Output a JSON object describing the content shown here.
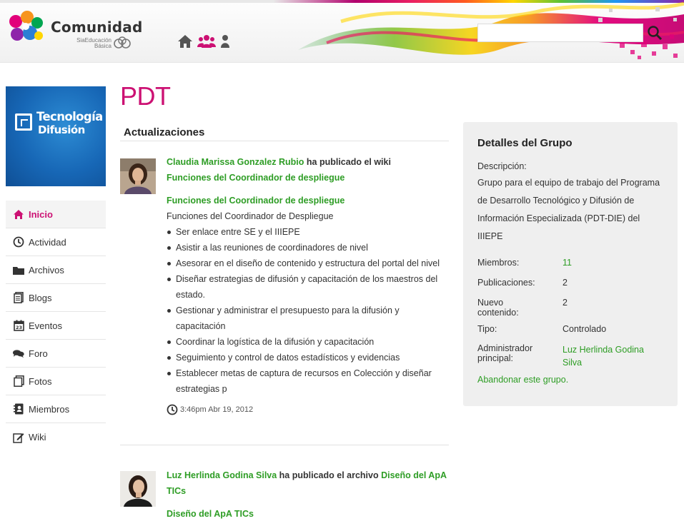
{
  "header": {
    "brand": "Comunidad",
    "brand_sub_line1": "SiaEducación",
    "brand_sub_line2": "Básica",
    "search_placeholder": "",
    "nav_icons": [
      "home-icon",
      "groups-icon",
      "profile-icon"
    ],
    "accent": "#cc1173"
  },
  "sidebar": {
    "owner_image_line1": "Tecnología",
    "owner_image_line2": "Difusión",
    "items": [
      {
        "label": "Inicio",
        "icon": "home-icon",
        "active": true
      },
      {
        "label": "Actividad",
        "icon": "clock-icon"
      },
      {
        "label": "Archivos",
        "icon": "folder-icon"
      },
      {
        "label": "Blogs",
        "icon": "blog-icon"
      },
      {
        "label": "Eventos",
        "icon": "calendar-icon"
      },
      {
        "label": "Foro",
        "icon": "chat-icon"
      },
      {
        "label": "Fotos",
        "icon": "photos-icon"
      },
      {
        "label": "Miembros",
        "icon": "address-book-icon"
      },
      {
        "label": "Wiki",
        "icon": "edit-icon"
      }
    ]
  },
  "main": {
    "title": "PDT",
    "updates_heading": "Actualizaciones",
    "updates": [
      {
        "author": "Claudia Marissa Gonzalez Rubio",
        "action": " ha publicado el wiki",
        "object": "Funciones del Coordinador de despliegue",
        "content_title": "Funciones del Coordinador de despliegue",
        "content_intro": "Funciones del Coordinador de Despliegue",
        "bullets": [
          "Ser enlace entre SE y el IIIEPE",
          "Asistir a las reuniones de coordinadores de nivel",
          "Asesorar en el diseño de contenido y estructura del portal del nivel",
          "Diseñar estrategias de difusión y capacitación de los maestros del estado.",
          "Gestionar y administrar el presupuesto para la difusión y capacitación",
          "Coordinar la logística de la difusión y capacitación",
          "Seguimiento y control de datos estadísticos y evidencias",
          "Establecer metas de captura de recursos en Colección y diseñar estrategias p"
        ],
        "timestamp": "3:46pm Abr 19, 2012"
      },
      {
        "author": "Luz Herlinda Godina Silva",
        "action": " ha publicado el archivo ",
        "object": "Diseño del ApA TICs",
        "content_title": "Diseño del ApA TICs"
      }
    ]
  },
  "details": {
    "heading": "Detalles del Grupo",
    "description_label": "Descripción:",
    "description": "Grupo para el equipo de trabajo del Programa de Desarrollo Tecnológico y Difusión de Información Especializada (PDT-DIE) del IIIEPE",
    "members_label": "Miembros:",
    "members_value": "11",
    "posts_label": "Publicaciones:",
    "posts_value": "2",
    "new_label_1": "Nuevo",
    "new_label_2": "contenido:",
    "new_value": "2",
    "type_label": "Tipo:",
    "type_value": "Controlado",
    "admin_label_1": "Administrador",
    "admin_label_2": "principal:",
    "admin_value_1": "Luz Herlinda Godina",
    "admin_value_2": "Silva",
    "leave_link": "Abandonar este grupo."
  }
}
